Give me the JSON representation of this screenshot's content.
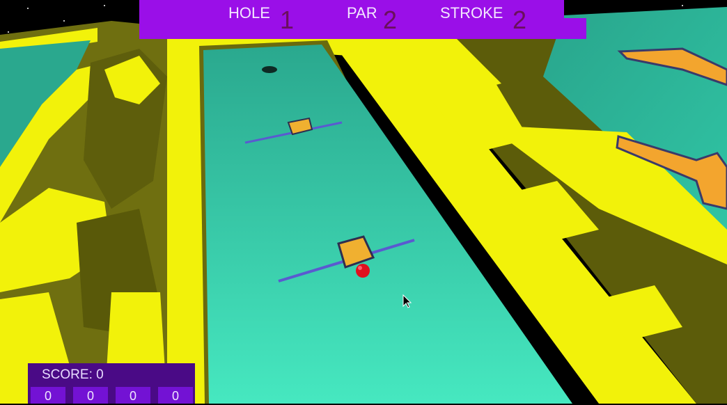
{
  "hud": {
    "hole_label": "HOLE",
    "hole_value": "1",
    "par_label": "PAR",
    "par_value": "2",
    "stroke_label": "STROKE",
    "stroke_value": "2"
  },
  "scoreboard": {
    "score_text": "SCORE: 0",
    "holes": [
      "0",
      "0",
      "0",
      "0"
    ]
  },
  "colors": {
    "hud_bg": "#9a0fe8",
    "wall_yellow": "#f2f20a",
    "wall_shadow": "#6e6e0a",
    "green": "#2fc6a2",
    "ball": "#e0101e",
    "obstacle": "#f0b030"
  }
}
